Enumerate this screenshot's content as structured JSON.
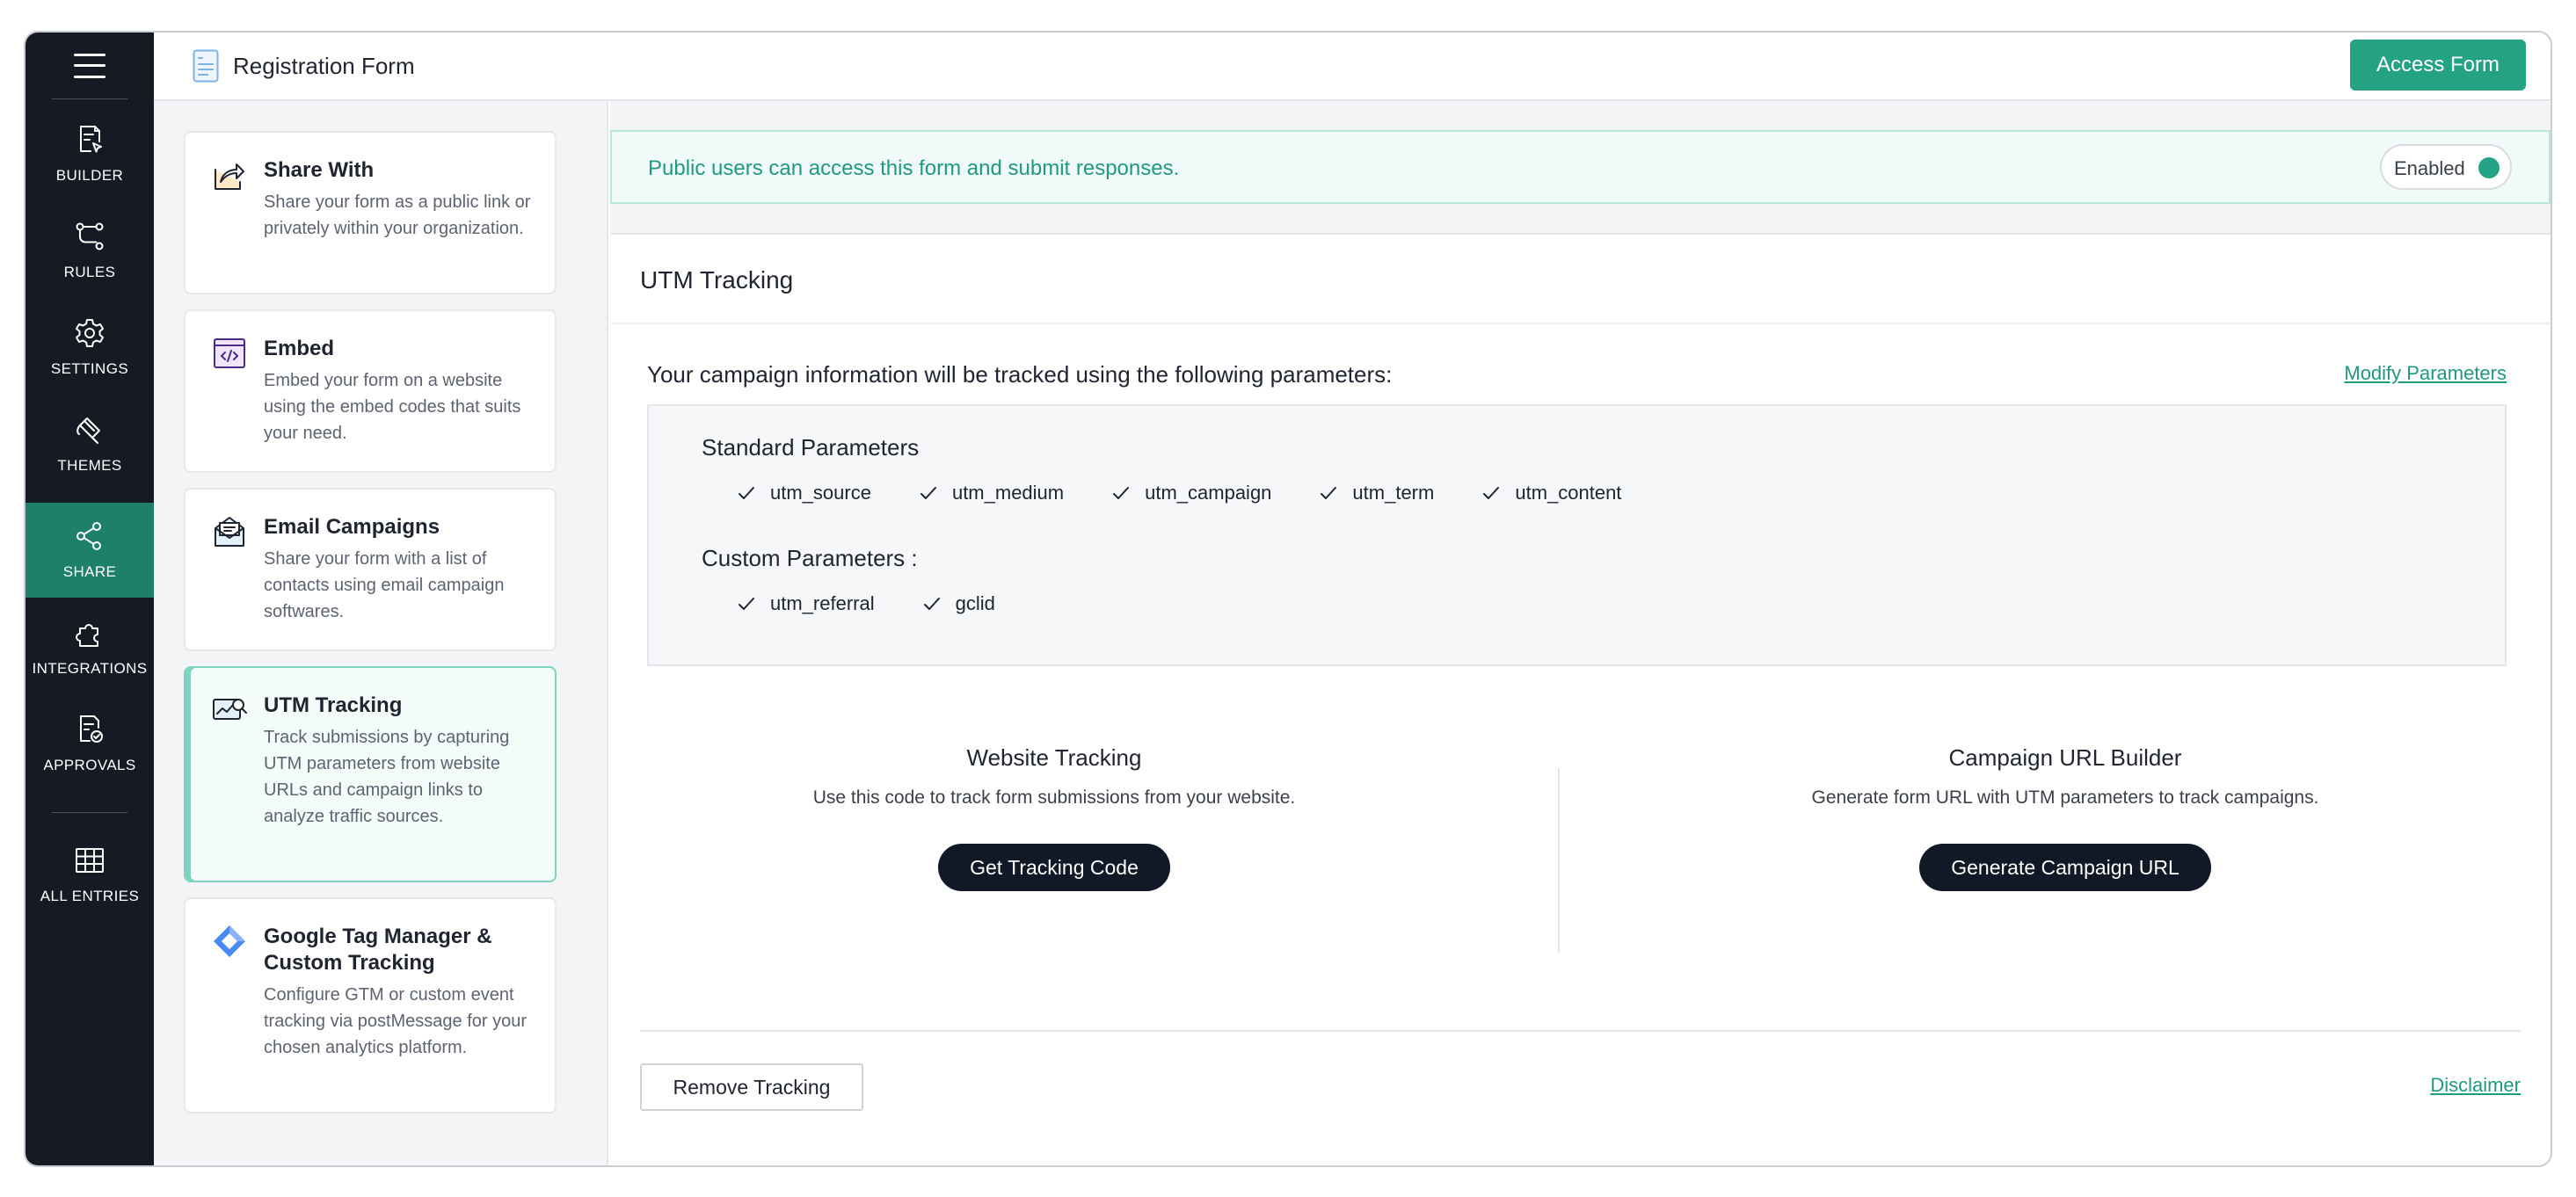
{
  "nav": {
    "items": [
      {
        "id": "builder",
        "label": "BUILDER",
        "icon": "form-cursor-icon"
      },
      {
        "id": "rules",
        "label": "RULES",
        "icon": "branch-icon"
      },
      {
        "id": "settings",
        "label": "SETTINGS",
        "icon": "gear-icon"
      },
      {
        "id": "themes",
        "label": "THEMES",
        "icon": "paint-icon"
      },
      {
        "id": "share",
        "label": "SHARE",
        "icon": "share-icon",
        "active": true
      },
      {
        "id": "integrations",
        "label": "INTEGRATIONS",
        "icon": "puzzle-icon"
      },
      {
        "id": "approvals",
        "label": "APPROVALS",
        "icon": "approval-icon"
      },
      {
        "id": "all-entries",
        "label": "ALL ENTRIES",
        "icon": "grid-icon"
      }
    ]
  },
  "header": {
    "title": "Registration Form",
    "access_button": "Access Form"
  },
  "cards": [
    {
      "title": "Share With",
      "description": "Share your form as a public link or privately within your organization.",
      "icon": "share-out-icon"
    },
    {
      "title": "Embed",
      "description": "Embed your form on a website using the embed codes that suits your need.",
      "icon": "embed-code-icon"
    },
    {
      "title": "Email Campaigns",
      "description": "Share your form with a list of contacts using email campaign softwares.",
      "icon": "email-campaign-icon"
    },
    {
      "title": "UTM Tracking",
      "description": "Track submissions by capturing UTM parameters from website URLs and campaign links to analyze traffic sources.",
      "icon": "utm-chart-icon",
      "active": true
    },
    {
      "title": "Google Tag Manager & Custom Tracking",
      "description": "Configure GTM or custom event tracking via postMessage for your chosen analytics platform.",
      "icon": "gtm-diamond-icon"
    }
  ],
  "banner": {
    "message": "Public users can access this form and submit responses.",
    "toggle_label": "Enabled"
  },
  "panel": {
    "title": "UTM Tracking",
    "intro": "Your campaign information will be tracked using the following parameters:",
    "modify_link": "Modify Parameters",
    "standard_heading": "Standard Parameters",
    "standard_params": [
      "utm_source",
      "utm_medium",
      "utm_campaign",
      "utm_term",
      "utm_content"
    ],
    "custom_heading": "Custom Parameters :",
    "custom_params": [
      "utm_referral",
      "gclid"
    ],
    "website_tracking": {
      "title": "Website Tracking",
      "description": "Use this code to track form submissions from your website.",
      "button": "Get Tracking Code"
    },
    "campaign_builder": {
      "title": "Campaign URL Builder",
      "description": "Generate form URL with UTM parameters to track campaigns.",
      "button": "Generate Campaign URL"
    },
    "remove_button": "Remove Tracking",
    "disclaimer_link": "Disclaimer"
  },
  "colors": {
    "accent": "#24a384",
    "rail": "#161a24",
    "rail_active": "#1e7f6a",
    "dark_button": "#111826"
  }
}
